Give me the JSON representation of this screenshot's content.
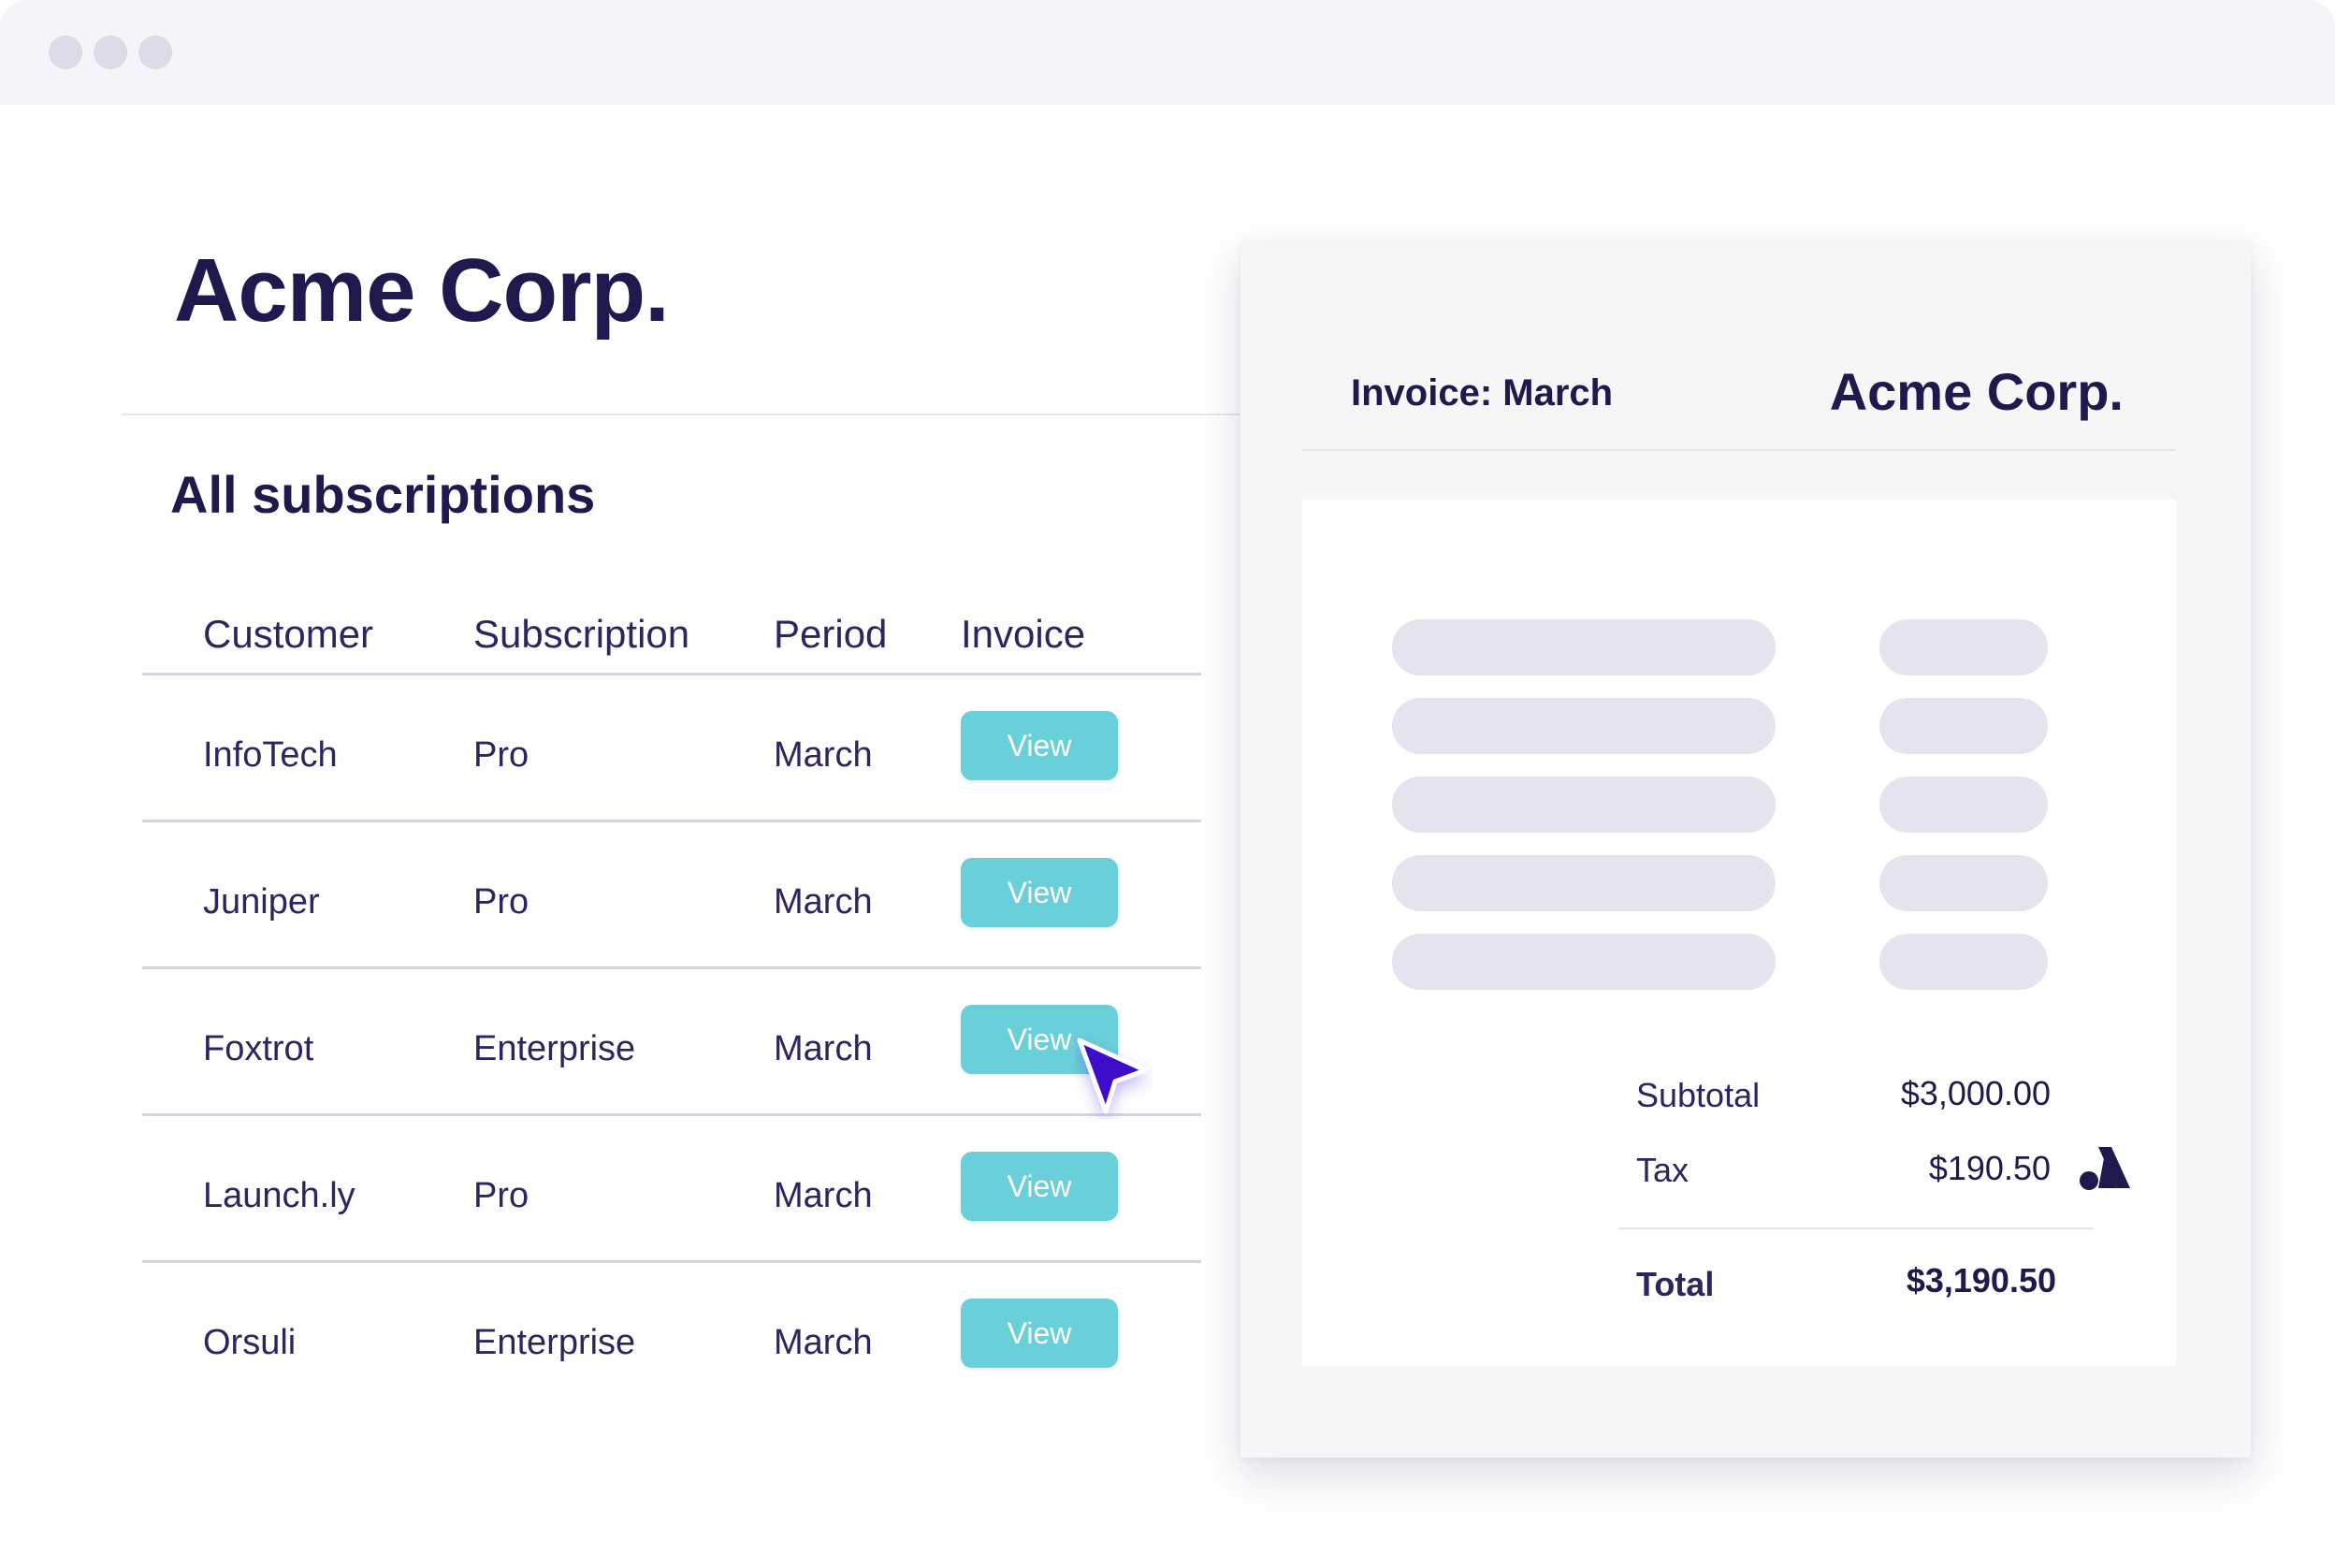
{
  "window": {
    "controls": [
      "close-dot",
      "minimize-dot",
      "maximize-dot"
    ]
  },
  "header": {
    "company_name": "Acme Corp."
  },
  "subscriptions": {
    "title": "All subscriptions",
    "columns": [
      "Customer",
      "Subscription",
      "Period",
      "Invoice"
    ],
    "rows": [
      {
        "customer": "InfoTech",
        "subscription": "Pro",
        "period": "March",
        "action": "View"
      },
      {
        "customer": "Juniper",
        "subscription": "Pro",
        "period": "March",
        "action": "View"
      },
      {
        "customer": "Foxtrot",
        "subscription": "Enterprise",
        "period": "March",
        "action": "View"
      },
      {
        "customer": "Launch.ly",
        "subscription": "Pro",
        "period": "March",
        "action": "View"
      },
      {
        "customer": "Orsuli",
        "subscription": "Enterprise",
        "period": "March",
        "action": "View"
      }
    ]
  },
  "invoice": {
    "heading": "Invoice: March",
    "company_name": "Acme Corp.",
    "line_item_placeholders": 5,
    "subtotal_label": "Subtotal",
    "subtotal_value": "$3,000.00",
    "tax_label": "Tax",
    "tax_value": "$190.50",
    "total_label": "Total",
    "total_value": "$3,190.50",
    "logo_icon": "brand-logo-icon"
  },
  "colors": {
    "primary_text": "#1f1a4d",
    "view_button": "#69cfd8",
    "cursor": "#3d0fc9",
    "placeholder": "#e5e4ee"
  }
}
